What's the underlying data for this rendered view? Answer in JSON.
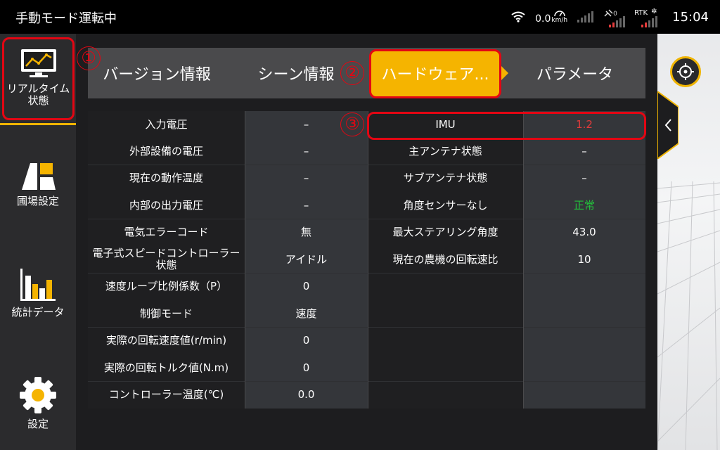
{
  "statusbar": {
    "title": "手動モード運転中",
    "speed_value": "0.0",
    "speed_unit": "km/h",
    "satellite_count": "0",
    "rtk_label": "RTK",
    "time": "15:04"
  },
  "sidebar": {
    "items": [
      {
        "label": "リアルタイム状態",
        "icon": "monitor-chart-icon"
      },
      {
        "label": "圃場設定",
        "icon": "field-icon"
      },
      {
        "label": "統計データ",
        "icon": "bar-chart-icon"
      },
      {
        "label": "設定",
        "icon": "gear-icon"
      }
    ]
  },
  "tabs": [
    {
      "label": "バージョン情報"
    },
    {
      "label": "シーン情報"
    },
    {
      "label": "ハードウェア..."
    },
    {
      "label": "パラメータ"
    }
  ],
  "markers": [
    "①",
    "②",
    "③"
  ],
  "table": {
    "left": [
      {
        "label": "入力電圧",
        "value": "–"
      },
      {
        "label": "外部設備の電圧",
        "value": "–"
      },
      {
        "label": "現在の動作温度",
        "value": "–"
      },
      {
        "label": "内部の出力電圧",
        "value": "–"
      },
      {
        "label": "電気エラーコード",
        "value": "無"
      },
      {
        "label": "電子式スピードコントローラー状態",
        "value": "アイドル"
      },
      {
        "label": "速度ループ比例係数（P）",
        "value": "0"
      },
      {
        "label": "制御モード",
        "value": "速度"
      },
      {
        "label": "実際の回転速度値(r/min)",
        "value": "0"
      },
      {
        "label": "実際の回転トルク値(N.m)",
        "value": "0"
      },
      {
        "label": "コントローラー温度(℃)",
        "value": "0.0"
      }
    ],
    "right": [
      {
        "label": "IMU",
        "value": "1.2"
      },
      {
        "label": "主アンテナ状態",
        "value": "–"
      },
      {
        "label": "サブアンテナ状態",
        "value": "–"
      },
      {
        "label": "角度センサーなし",
        "value": "正常"
      },
      {
        "label": "最大ステアリング角度",
        "value": "43.0"
      },
      {
        "label": "現在の農機の回転速比",
        "value": "10"
      }
    ]
  },
  "colors": {
    "accent": "#f5b400",
    "highlight": "#e30613",
    "ok": "#22c43b",
    "warn": "#e23b3b"
  }
}
